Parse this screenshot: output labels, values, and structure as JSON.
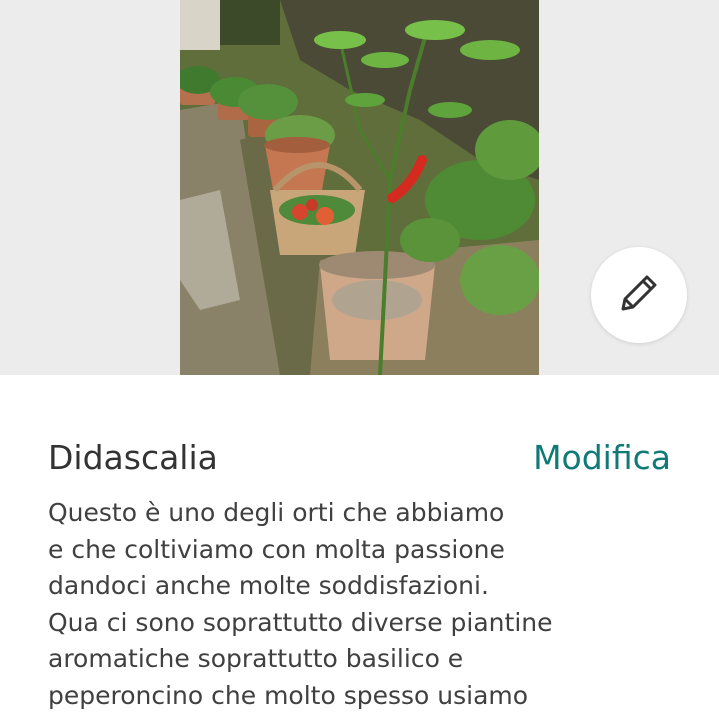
{
  "photo": {
    "subject": "garden-photo"
  },
  "edit_button": {
    "icon": "pencil-icon"
  },
  "caption": {
    "title": "Didascalia",
    "edit_label": "Modifica",
    "text": "Questo è uno degli orti che abbiamo\ne che coltiviamo con molta passione\ndandoci anche molte soddisfazioni.\nQua ci sono soprattutto diverse piantine\naromatiche soprattutto basilico e\npeperoncino che molto spesso usiamo"
  },
  "colors": {
    "accent": "#117a76",
    "text_primary": "#333333",
    "text_body": "#404040",
    "photo_background": "#ececec"
  }
}
